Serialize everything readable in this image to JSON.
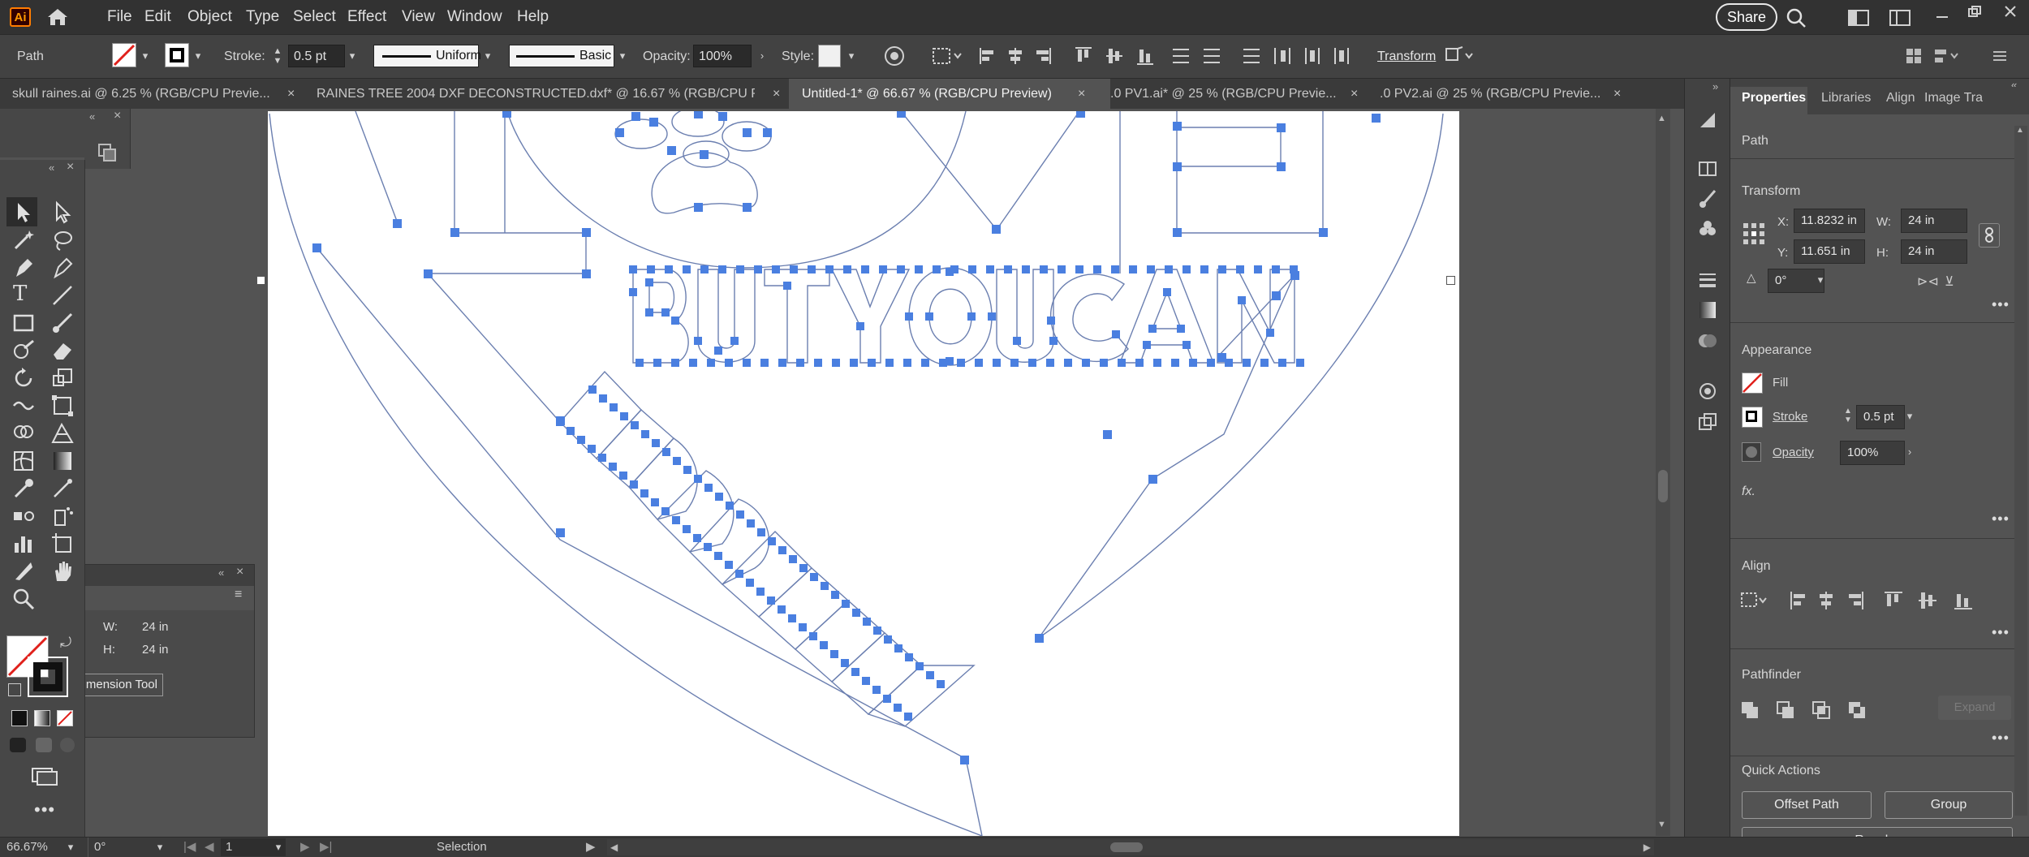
{
  "app": {
    "logo": "Ai"
  },
  "menu": [
    "File",
    "Edit",
    "Object",
    "Type",
    "Select",
    "Effect",
    "View",
    "Window",
    "Help"
  ],
  "share_label": "Share",
  "control": {
    "object_type": "Path",
    "stroke_label": "Stroke:",
    "stroke_weight": "0.5 pt",
    "profile_uniform": "Uniform",
    "brush_basic": "Basic",
    "opacity_label": "Opacity:",
    "opacity_value": "100%",
    "style_label": "Style:",
    "transform_label": "Transform"
  },
  "tabs": [
    {
      "label": "skull raines.ai @ 6.25 % (RGB/CPU Previe...",
      "active": false
    },
    {
      "label": "RAINES TREE 2004 DXF DECONSTRUCTED.dxf* @ 16.67 % (RGB/CPU P...",
      "active": false
    },
    {
      "label": "Untitled-1* @ 66.67 % (RGB/CPU Preview)",
      "active": true
    },
    {
      "label": ".0 PV1.ai* @ 25 % (RGB/CPU Previe...",
      "active": false
    },
    {
      "label": ".0 PV2.ai @ 25 % (RGB/CPU Previe...",
      "active": false
    }
  ],
  "tab_close": "×",
  "props": {
    "tabs": [
      "Properties",
      "Libraries",
      "Align",
      "Image Tra"
    ],
    "object": "Path",
    "transform_title": "Transform",
    "x_label": "X:",
    "x_value": "11.8232 in",
    "y_label": "Y:",
    "y_value": "11.651 in",
    "w_label": "W:",
    "w_value": "24 in",
    "h_label": "H:",
    "h_value": "24 in",
    "rotate_value": "0°",
    "appearance_title": "Appearance",
    "fill_label": "Fill",
    "stroke_label": "Stroke",
    "stroke_value": "0.5 pt",
    "opacity_label": "Opacity",
    "opacity_value": "100%",
    "fx_label": "fx.",
    "align_title": "Align",
    "pathfinder_title": "Pathfinder",
    "expand_label": "Expand",
    "quick_actions_title": "Quick Actions",
    "offset_path": "Offset Path",
    "group": "Group",
    "recolor": "Recolor"
  },
  "float_panel": {
    "w_label": "W:",
    "w_value": "24 in",
    "h_label": "H:",
    "h_value": "24 in",
    "tool_button": "mension Tool"
  },
  "status": {
    "zoom": "66.67%",
    "rotation": "0°",
    "artboard": "1",
    "tool": "Selection"
  },
  "colors": {
    "anchor": "#4a7fe0",
    "path": "#6b7fb0",
    "accent_logo": "#ff9a00"
  }
}
